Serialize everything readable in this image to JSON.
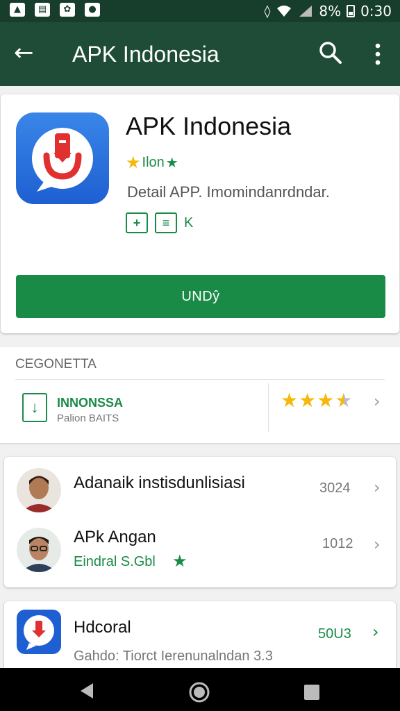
{
  "status_bar": {
    "left_icons": [
      "image-icon",
      "gallery-icon",
      "app-icon",
      "chat-icon"
    ],
    "battery": "8%",
    "time": "0:30"
  },
  "app_bar": {
    "title": "APK Indonesia"
  },
  "app": {
    "name": "APK Indonesia",
    "rating_text": "Ilon",
    "description": "Detail APP. Imomindanrdndar.",
    "badge_extra": "K",
    "install_label": "UNDŷ"
  },
  "publisher_section": {
    "label": "CEGONETTA",
    "name": "INNONSSA",
    "sub": "Palion BAITS",
    "stars": 3.5
  },
  "list": [
    {
      "title": "Adanaik instisdunlisiasi",
      "sub": "",
      "num": "3024"
    },
    {
      "title": "APk Angan",
      "sub": "Eindral S.Gbl",
      "num": "1012"
    }
  ],
  "bottom_item": {
    "title": "Hdcoral",
    "sub": "Gahdo: Tiorct Ierenunalndan 3.3",
    "num": "50U3"
  },
  "colors": {
    "status_bar": "#173d2c",
    "app_bar": "#1f4c37",
    "accent_green": "#1a8a47",
    "star_gold": "#f5b80b",
    "app_icon_blue": "#1e5fd2"
  }
}
